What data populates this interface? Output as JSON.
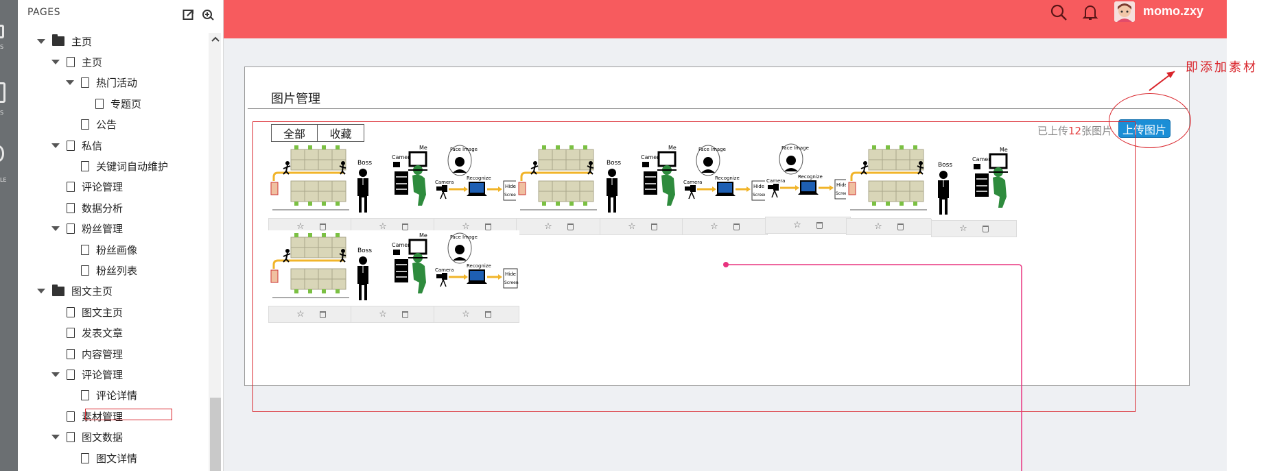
{
  "sidebar": {
    "title": "PAGES",
    "nodes": [
      {
        "label": "主页",
        "type": "folder",
        "level": 0,
        "expanded": true
      },
      {
        "label": "主页",
        "type": "file",
        "level": 1,
        "expanded": true
      },
      {
        "label": "热门活动",
        "type": "file",
        "level": 2,
        "expanded": true
      },
      {
        "label": "专题页",
        "type": "file",
        "level": 3
      },
      {
        "label": "公告",
        "type": "file",
        "level": 2
      },
      {
        "label": "私信",
        "type": "file",
        "level": 1,
        "expanded": true
      },
      {
        "label": "关键词自动维护",
        "type": "file",
        "level": 2
      },
      {
        "label": "评论管理",
        "type": "file",
        "level": 1
      },
      {
        "label": "数据分析",
        "type": "file",
        "level": 1
      },
      {
        "label": "粉丝管理",
        "type": "file",
        "level": 1,
        "expanded": true
      },
      {
        "label": "粉丝画像",
        "type": "file",
        "level": 2
      },
      {
        "label": "粉丝列表",
        "type": "file",
        "level": 2
      },
      {
        "label": "图文主页",
        "type": "folder",
        "level": 0,
        "expanded": true
      },
      {
        "label": "图文主页",
        "type": "file",
        "level": 1
      },
      {
        "label": "发表文章",
        "type": "file",
        "level": 1
      },
      {
        "label": "内容管理",
        "type": "file",
        "level": 1
      },
      {
        "label": "评论管理",
        "type": "file",
        "level": 1,
        "expanded": true
      },
      {
        "label": "评论详情",
        "type": "file",
        "level": 2
      },
      {
        "label": "素材管理",
        "type": "file",
        "level": 1,
        "selected": true
      },
      {
        "label": "图文数据",
        "type": "file",
        "level": 1,
        "expanded": true
      },
      {
        "label": "图文详情",
        "type": "file",
        "level": 2
      }
    ]
  },
  "leftstrip": {
    "labels": [
      "S",
      "S",
      "LE"
    ]
  },
  "topbar": {
    "username": "momo.zxy",
    "color": "#f75b5e"
  },
  "card": {
    "title": "图片管理",
    "tabs": [
      "全部",
      "收藏"
    ],
    "uploaded_prefix": "已上传",
    "uploaded_count": "12",
    "uploaded_suffix": "张图片",
    "upload_button": "上传图片"
  },
  "images": [
    {
      "kind": "room"
    },
    {
      "kind": "boss"
    },
    {
      "kind": "face"
    },
    {
      "kind": "room"
    },
    {
      "kind": "boss"
    },
    {
      "kind": "face"
    },
    {
      "kind": "face"
    },
    {
      "kind": "room"
    },
    {
      "kind": "boss"
    },
    {
      "kind": "room"
    },
    {
      "kind": "boss"
    },
    {
      "kind": "face"
    }
  ],
  "illustration_text": {
    "boss": "Boss",
    "camera": "Camera",
    "me": "Me",
    "face_image": "Face Image",
    "recognize": "Recognize",
    "hide": "Hide",
    "screen": "Screen"
  },
  "annotation": {
    "text": "即添加素材",
    "color": "#d9232a"
  }
}
